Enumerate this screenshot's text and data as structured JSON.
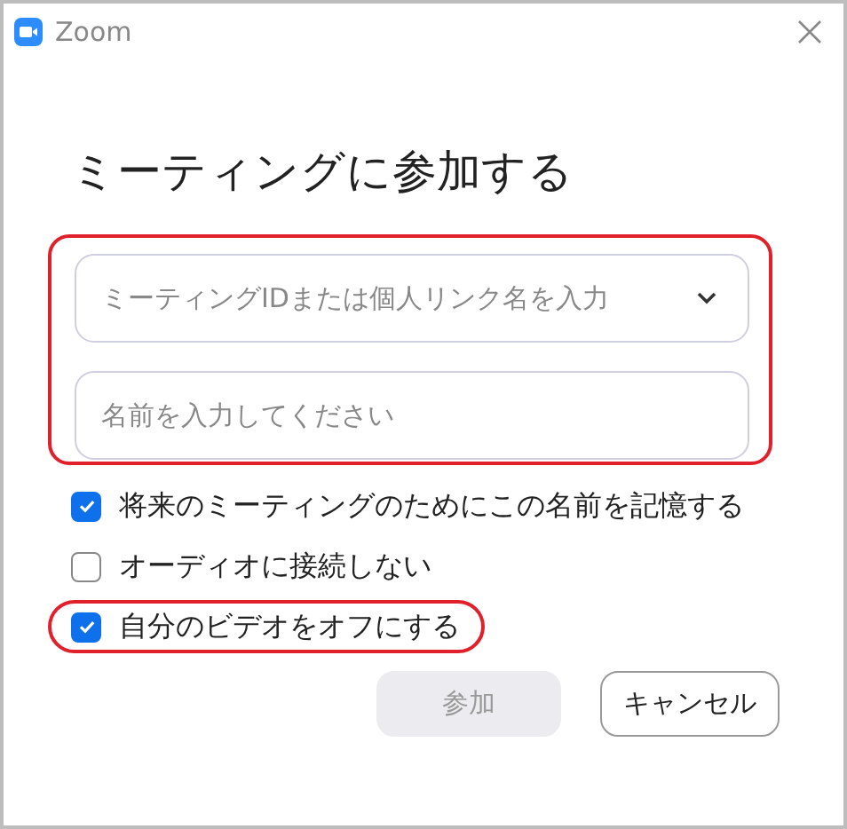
{
  "window": {
    "title": "Zoom"
  },
  "heading": "ミーティングに参加する",
  "fields": {
    "highlighted": true,
    "items": [
      {
        "kind": "dropdown",
        "placeholder": "ミーティングIDまたは個人リンク名を入力"
      },
      {
        "kind": "text",
        "placeholder": "名前を入力してください"
      }
    ]
  },
  "options": [
    {
      "label": "将来のミーティングのためにこの名前を記憶する",
      "checked": true,
      "highlighted": false
    },
    {
      "label": "オーディオに接続しない",
      "checked": false,
      "highlighted": false
    },
    {
      "label": "自分のビデオをオフにする",
      "checked": true,
      "highlighted": true
    }
  ],
  "buttons": [
    {
      "label": "参加",
      "disabled": true
    },
    {
      "label": "キャンセル",
      "disabled": false
    }
  ]
}
